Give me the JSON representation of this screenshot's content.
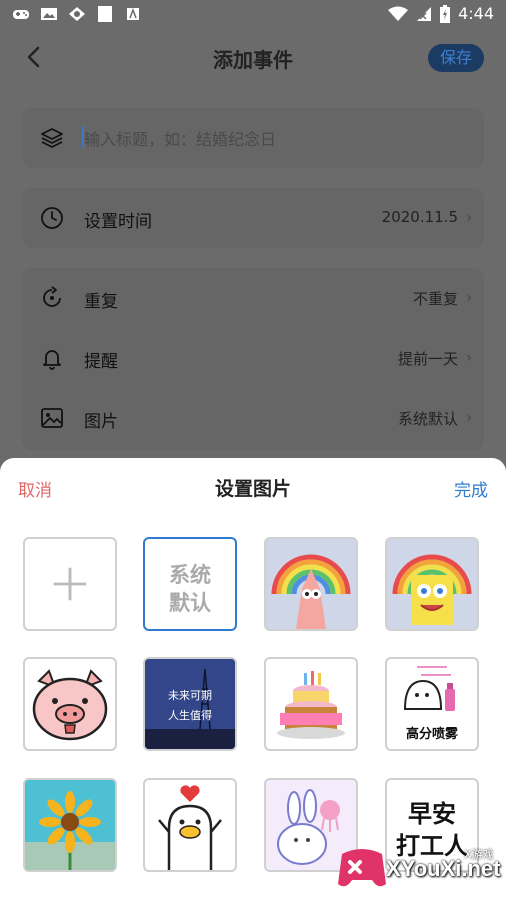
{
  "status": {
    "time": "4:44"
  },
  "header": {
    "title": "添加事件",
    "save_label": "保存"
  },
  "form": {
    "title_placeholder": "输入标题，如：结婚纪念日",
    "time": {
      "label": "设置时间",
      "value": "2020.11.5"
    },
    "repeat": {
      "label": "重复",
      "value": "不重复"
    },
    "remind": {
      "label": "提醒",
      "value": "提前一天"
    },
    "image": {
      "label": "图片",
      "value": "系统默认"
    }
  },
  "sheet": {
    "cancel_label": "取消",
    "title": "设置图片",
    "done_label": "完成",
    "tiles": {
      "default_text_1": "系统",
      "default_text_2": "默认",
      "photo_caption_1": "未来可期",
      "photo_caption_2": "人生值得",
      "spray_caption": "高分喷雾",
      "greeting_1": "早安",
      "greeting_2": "打工人"
    }
  },
  "watermark": {
    "brand": "XYouXi.net",
    "small": "X游戏"
  },
  "colors": {
    "accent": "#2f7bd1",
    "cancel": "#e06767",
    "overlay": "#6b6b6b"
  }
}
